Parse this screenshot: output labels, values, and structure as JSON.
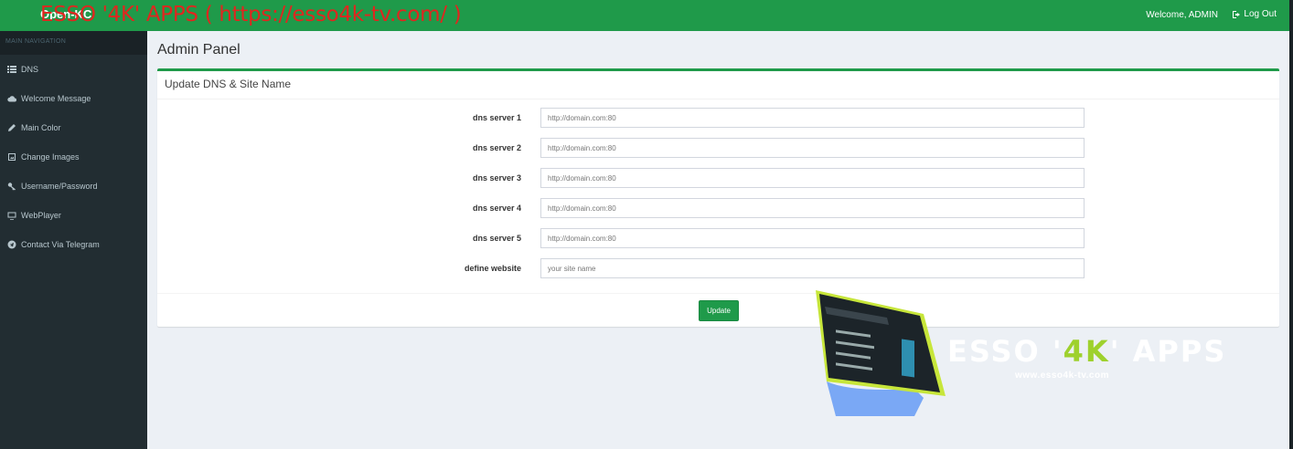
{
  "header": {
    "logo": "Open-KC",
    "banner": "ESSO '4K' APPS (  https://esso4k-tv.com/ )",
    "welcome": "Welcome, ADMIN",
    "logout": "Log Out"
  },
  "sidebar": {
    "header": "MAIN NAVIGATION",
    "items": [
      {
        "label": "DNS",
        "icon": "list-icon"
      },
      {
        "label": "Welcome Message",
        "icon": "cloud-icon"
      },
      {
        "label": "Main Color",
        "icon": "pencil-icon"
      },
      {
        "label": "Change Images",
        "icon": "image-icon"
      },
      {
        "label": "Username/Password",
        "icon": "key-icon"
      },
      {
        "label": "WebPlayer",
        "icon": "monitor-icon"
      },
      {
        "label": "Contact Via Telegram",
        "icon": "telegram-icon"
      }
    ]
  },
  "main": {
    "title": "Admin Panel",
    "box_title": "Update DNS & Site Name",
    "fields": [
      {
        "label": "dns server 1",
        "placeholder": "http://domain.com:80"
      },
      {
        "label": "dns server 2",
        "placeholder": "http://domain.com:80"
      },
      {
        "label": "dns server 3",
        "placeholder": "http://domain.com:80"
      },
      {
        "label": "dns server 4",
        "placeholder": "http://domain.com:80"
      },
      {
        "label": "dns server 5",
        "placeholder": "http://domain.com:80"
      },
      {
        "label": "define website",
        "placeholder": "your site name"
      }
    ],
    "update_label": "Update"
  },
  "watermark": {
    "brand_a": "ESSO '",
    "brand_hl": "4K",
    "brand_b": "' APPS",
    "url": "www.esso4k-tv.com"
  },
  "colors": {
    "header": "#1f9a4a",
    "sidebar": "#222d32",
    "banner_text": "#e0261f",
    "accent_green": "#9ed12d"
  }
}
